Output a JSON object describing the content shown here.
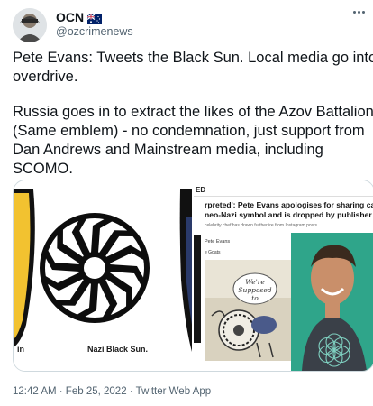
{
  "user": {
    "name": "OCN",
    "handle": "@ozcrimenews"
  },
  "tweet": {
    "paragraphs": [
      "Pete Evans: Tweets the Black Sun.  Local media go into",
      "overdrive."
    ],
    "paragraph2": [
      "Russia goes in to extract the likes of the Azov Battalion",
      "(Same emblem) - no condemnation, just support from",
      "Dan Andrews and Mainstream media, including",
      "SCOMO."
    ],
    "timestamp": "12:42 AM · Feb 25, 2022 · Twitter Web App"
  },
  "media": {
    "left_image": {
      "caption": "Nazi Black Sun.",
      "caption_left": "in"
    },
    "right_image": {
      "kicker": "ED",
      "headline": [
        "rpreted': Pete Evans apologises for sharing cartoon",
        "neo-Nazi symbol and is dropped by publisher"
      ],
      "subline": "celebrity chef has drawn further ire from Instagram posts",
      "post_author": "Pete Evans",
      "post_text": "e Goats",
      "bubble_text": "We're Supposed to"
    }
  },
  "colors": {
    "handle_gray": "#536471",
    "border": "#cfd9de",
    "shirt": "#3a4048"
  }
}
